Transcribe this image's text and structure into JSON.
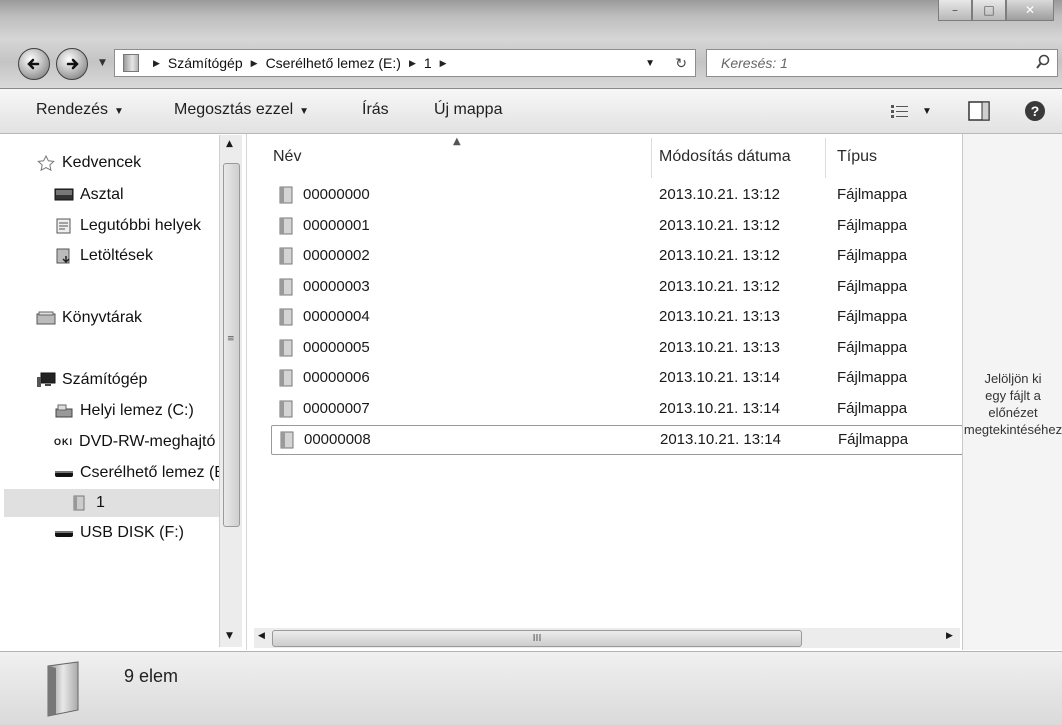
{
  "window": {
    "minimize_glyph": "–",
    "maximize_glyph": "□",
    "close_glyph": "✕"
  },
  "address": {
    "crumbs": [
      "Számítógép",
      "Cserélhető lemez (E:)",
      "1"
    ],
    "search_placeholder": "Keresés: 1"
  },
  "toolbar": {
    "organize": "Rendezés",
    "share": "Megosztás ezzel",
    "burn": "Írás",
    "new_folder": "Új mappa"
  },
  "nav": {
    "favorites": "Kedvencek",
    "desktop": "Asztal",
    "recent": "Legutóbbi helyek",
    "downloads": "Letöltések",
    "libraries": "Könyvtárak",
    "computer": "Számítógép",
    "local_disk": "Helyi lemez (C:)",
    "dvd": "DVD-RW-meghajtó",
    "dvd_badge": "OKI",
    "removable": "Cserélhető lemez (E:)",
    "folder1": "1",
    "usb": "USB DISK (F:)"
  },
  "columns": {
    "name": "Név",
    "modified": "Módosítás dátuma",
    "type": "Típus"
  },
  "files": [
    {
      "name": "00000000",
      "date": "2013.10.21. 13:12",
      "type": "Fájlmappa"
    },
    {
      "name": "00000001",
      "date": "2013.10.21. 13:12",
      "type": "Fájlmappa"
    },
    {
      "name": "00000002",
      "date": "2013.10.21. 13:12",
      "type": "Fájlmappa"
    },
    {
      "name": "00000003",
      "date": "2013.10.21. 13:12",
      "type": "Fájlmappa"
    },
    {
      "name": "00000004",
      "date": "2013.10.21. 13:13",
      "type": "Fájlmappa"
    },
    {
      "name": "00000005",
      "date": "2013.10.21. 13:13",
      "type": "Fájlmappa"
    },
    {
      "name": "00000006",
      "date": "2013.10.21. 13:14",
      "type": "Fájlmappa"
    },
    {
      "name": "00000007",
      "date": "2013.10.21. 13:14",
      "type": "Fájlmappa"
    },
    {
      "name": "00000008",
      "date": "2013.10.21. 13:14",
      "type": "Fájlmappa"
    }
  ],
  "preview": {
    "line1": "Jelöljön ki",
    "line2": "egy fájlt a",
    "line3": "előnézet megtekintéséhez"
  },
  "status": {
    "count": "9 elem"
  },
  "scrollbar": {
    "grip": "III"
  }
}
